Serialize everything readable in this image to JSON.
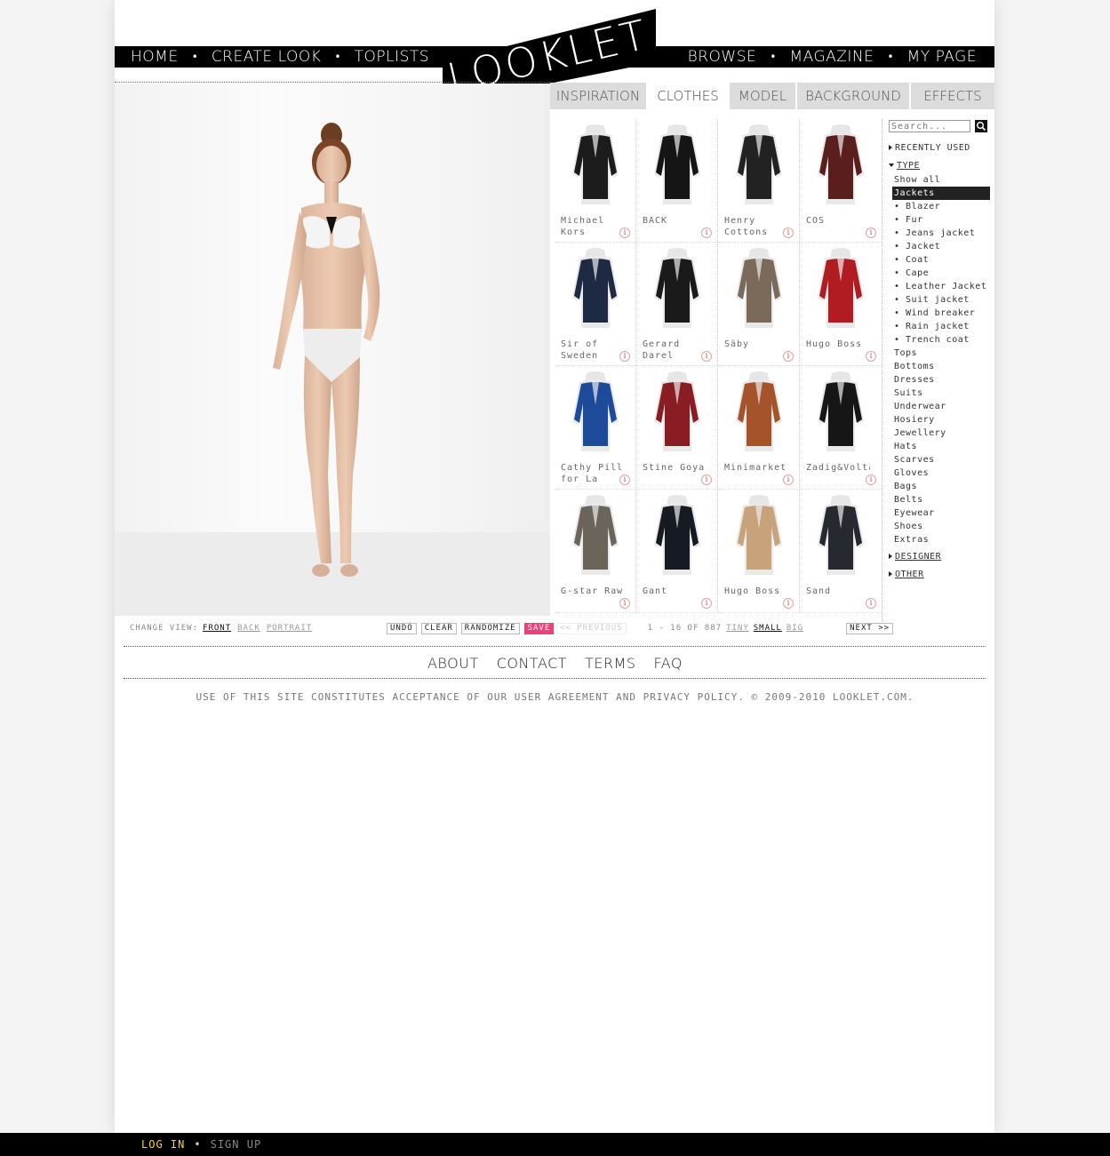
{
  "nav": {
    "left": [
      "HOME",
      "CREATE LOOK",
      "TOPLISTS"
    ],
    "right": [
      "BROWSE",
      "MAGAZINE",
      "MY PAGE"
    ],
    "logo_text": "LOOKLET"
  },
  "tabs": [
    "INSPIRATION",
    "CLOTHES",
    "MODEL",
    "BACKGROUND",
    "EFFECTS"
  ],
  "active_tab": "CLOTHES",
  "items": [
    {
      "brand": "Michael Kors",
      "color": "#1c1c1c"
    },
    {
      "brand": "BACK",
      "color": "#151515"
    },
    {
      "brand": "Henry Cottons",
      "color": "#222222"
    },
    {
      "brand": "COS",
      "color": "#5a1f1c"
    },
    {
      "brand": "Sir of Sweden",
      "color": "#1e2a44"
    },
    {
      "brand": "Gerard Darel",
      "color": "#1a1a1a"
    },
    {
      "brand": "Säby",
      "color": "#7a6a5a"
    },
    {
      "brand": "Hugo Boss",
      "color": "#b01c22"
    },
    {
      "brand": "Cathy Pill for La Redoute",
      "color": "#1e4a9a"
    },
    {
      "brand": "Stine Goya",
      "color": "#8a1d24"
    },
    {
      "brand": "Minimarket",
      "color": "#a4532a"
    },
    {
      "brand": "Zadig&Voltaire",
      "color": "#161616"
    },
    {
      "brand": "G-star Raw",
      "color": "#6a645a"
    },
    {
      "brand": "Gant",
      "color": "#161a22"
    },
    {
      "brand": "Hugo Boss",
      "color": "#c8a27a"
    },
    {
      "brand": "Sand",
      "color": "#262a30"
    }
  ],
  "sidebar": {
    "search_placeholder": "Search...",
    "recently_used": "RECENTLY USED",
    "type": "TYPE",
    "types": [
      "Show all",
      "Jackets",
      "• Blazer",
      "• Fur",
      "• Jeans jacket",
      "• Jacket",
      "• Coat",
      "• Cape",
      "• Leather Jacket",
      "• Suit jacket",
      "• Wind breaker",
      "• Rain jacket",
      "• Trench coat",
      "Tops",
      "Bottoms",
      "Dresses",
      "Suits",
      "Underwear",
      "Hosiery",
      "Jewellery",
      "Hats",
      "Scarves",
      "Gloves",
      "Bags",
      "Belts",
      "Eyewear",
      "Shoes",
      "Extras"
    ],
    "selected_type": "Jackets",
    "designer": "DESIGNER",
    "other": "OTHER"
  },
  "controls": {
    "change_view": "CHANGE VIEW:",
    "views": [
      "FRONT",
      "BACK",
      "PORTRAIT"
    ],
    "active_view": "FRONT",
    "undo": "UNDO",
    "clear": "CLEAR",
    "randomize": "RANDOMIZE",
    "save": "SAVE"
  },
  "pagination": {
    "previous": "<< PREVIOUS",
    "range": "1 - 16 OF 887",
    "sizes": [
      "TINY",
      "SMALL",
      "BIG"
    ],
    "active_size": "SMALL",
    "next": "NEXT >>"
  },
  "footer": {
    "links": [
      "ABOUT",
      "CONTACT",
      "TERMS",
      "FAQ"
    ],
    "legal": "USE OF THIS SITE CONSTITUTES ACCEPTANCE OF OUR USER AGREEMENT AND PRIVACY POLICY. © 2009-2010 LOOKLET.COM."
  },
  "bottombar": {
    "login": "LOG IN",
    "signup": "SIGN UP"
  },
  "colors": {
    "save_pink": "#f0407a",
    "login_yellow": "#f6d23a"
  }
}
